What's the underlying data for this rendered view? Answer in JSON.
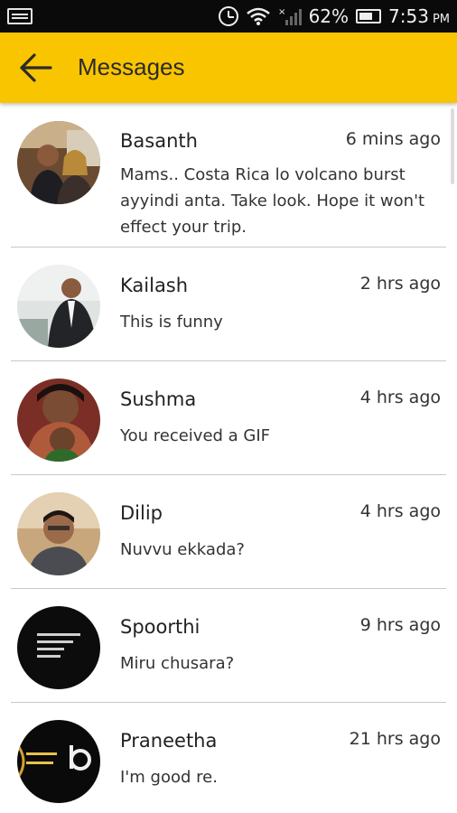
{
  "status_bar": {
    "battery": "62%",
    "time": "7:53",
    "ampm": "PM",
    "icons": [
      "notification-icon",
      "alarm-icon",
      "wifi-icon",
      "signal-icon",
      "battery-icon"
    ]
  },
  "app_bar": {
    "title": "Messages",
    "back_icon": "arrow-left-icon",
    "color": "#f9c400"
  },
  "conversations": [
    {
      "name": "Basanth",
      "time": "6 mins ago",
      "message": "Mams.. Costa Rica lo volcano burst ayyindi anta. Take look. Hope it won't effect your trip."
    },
    {
      "name": "Kailash",
      "time": "2 hrs ago",
      "message": "This is funny"
    },
    {
      "name": "Sushma",
      "time": "4 hrs ago",
      "message": "You received a GIF"
    },
    {
      "name": "Dilip",
      "time": "4 hrs ago",
      "message": "Nuvvu ekkada?"
    },
    {
      "name": "Spoorthi",
      "time": "9 hrs ago",
      "message": "Miru chusara?"
    },
    {
      "name": "Praneetha",
      "time": "21 hrs ago",
      "message": "I'm good re."
    }
  ]
}
